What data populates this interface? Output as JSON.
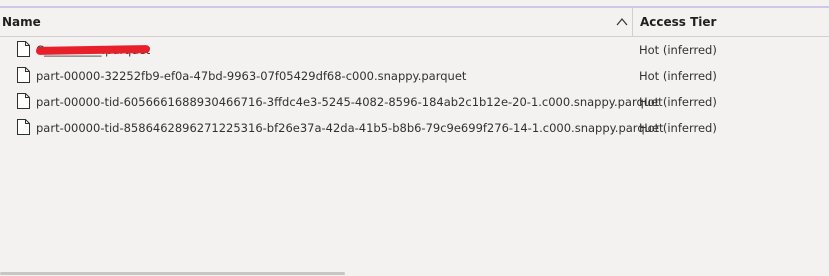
{
  "columns": {
    "name": "Name",
    "access_tier": "Access Tier",
    "sort_icon": "chevron-up-icon"
  },
  "files": [
    {
      "name": "C__________.parquet",
      "tier": "Hot (inferred)",
      "redacted": true
    },
    {
      "name": "part-00000-32252fb9-ef0a-47bd-9963-07f05429df68-c000.snappy.parquet",
      "tier": "Hot (inferred)"
    },
    {
      "name": "part-00000-tid-6056661688930466716-3ffdc4e3-5245-4082-8596-184ab2c1b12e-20-1.c000.snappy.parquet",
      "tier": "Hot (inferred)"
    },
    {
      "name": "part-00000-tid-8586462896271225316-bf26e37a-42da-41b5-b8b6-79c9e699f276-14-1.c000.snappy.parquet",
      "tier": "Hot (inferred)"
    }
  ],
  "colors": {
    "background": "#f3f2f1",
    "redaction": "#e8202a"
  }
}
